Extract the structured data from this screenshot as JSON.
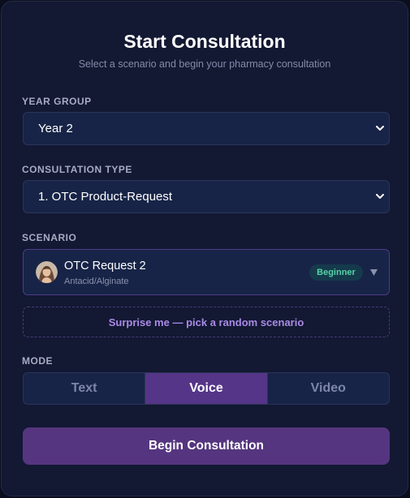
{
  "header": {
    "title": "Start Consultation",
    "subtitle": "Select a scenario and begin your pharmacy consultation"
  },
  "year_group": {
    "label": "YEAR GROUP",
    "selected": "Year 2"
  },
  "consultation_type": {
    "label": "CONSULTATION TYPE",
    "selected": "1. OTC Product-Request"
  },
  "scenario": {
    "label": "SCENARIO",
    "title": "OTC Request 2",
    "subtitle": "Antacid/Alginate",
    "badge": "Beginner",
    "avatar_icon": "patient-avatar",
    "caret_icon": "caret-down-icon"
  },
  "surprise_button": "Surprise me — pick a random scenario",
  "mode": {
    "label": "MODE",
    "options": [
      "Text",
      "Voice",
      "Video"
    ],
    "selected": "Voice"
  },
  "begin_button": "Begin Consultation",
  "colors": {
    "background": "#131833",
    "accent": "#55357f",
    "badge_text": "#58d2a6",
    "surprise_text": "#a98ae6"
  }
}
